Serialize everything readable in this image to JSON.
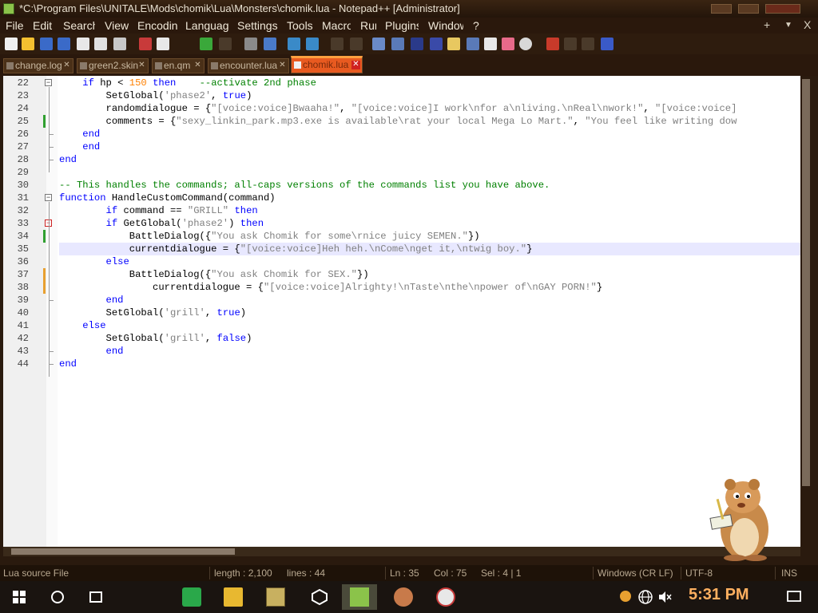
{
  "window": {
    "title": "*C:\\Program Files\\UNITALE\\Mods\\chomik\\Lua\\Monsters\\chomik.lua - Notepad++ [Administrator]"
  },
  "menu": {
    "items": [
      "File",
      "Edit",
      "Search",
      "View",
      "Encoding",
      "Language",
      "Settings",
      "Tools",
      "Macro",
      "Run",
      "Plugins",
      "Window",
      "?"
    ],
    "right_plus": "+",
    "right_down": "▼",
    "right_close": "X"
  },
  "tabs": [
    {
      "label": "change.log",
      "active": false
    },
    {
      "label": "green2.skin",
      "active": false
    },
    {
      "label": "en.qm",
      "active": false
    },
    {
      "label": "encounter.lua",
      "active": false
    },
    {
      "label": "chomik.lua",
      "active": true
    }
  ],
  "editor": {
    "lines": [
      {
        "num": "22",
        "segments": [
          [
            "",
            "    "
          ],
          [
            "kw",
            "if"
          ],
          [
            "",
            " hp < "
          ],
          [
            "num",
            "150"
          ],
          [
            "",
            " "
          ],
          [
            "kw",
            "then"
          ],
          [
            "",
            "    "
          ],
          [
            "cmt",
            "--activate 2nd phase"
          ]
        ]
      },
      {
        "num": "23",
        "segments": [
          [
            "",
            "        SetGlobal("
          ],
          [
            "str",
            "'phase2'"
          ],
          [
            "",
            ", "
          ],
          [
            "kw",
            "true"
          ],
          [
            "",
            ")"
          ]
        ]
      },
      {
        "num": "24",
        "segments": [
          [
            "",
            "        randomdialogue = {"
          ],
          [
            "str",
            "\"[voice:voice]Bwaaha!\""
          ],
          [
            "",
            ", "
          ],
          [
            "str",
            "\"[voice:voice]I work\\nfor a\\nliving.\\nReal\\nwork!\""
          ],
          [
            "",
            ", "
          ],
          [
            "str",
            "\"[voice:voice]"
          ]
        ]
      },
      {
        "num": "25",
        "segments": [
          [
            "",
            "        comments = {"
          ],
          [
            "str",
            "\"sexy_linkin_park.mp3.exe is available\\rat your local Mega Lo Mart.\""
          ],
          [
            "",
            ", "
          ],
          [
            "str",
            "\"You feel like writing dow"
          ]
        ]
      },
      {
        "num": "26",
        "segments": [
          [
            "",
            "    "
          ],
          [
            "kw",
            "end"
          ]
        ]
      },
      {
        "num": "27",
        "segments": [
          [
            "",
            "    "
          ],
          [
            "kw",
            "end"
          ]
        ]
      },
      {
        "num": "28",
        "segments": [
          [
            "kw",
            "end"
          ]
        ]
      },
      {
        "num": "29",
        "segments": [
          [
            "",
            ""
          ]
        ]
      },
      {
        "num": "30",
        "segments": [
          [
            "cmt",
            "-- This handles the commands; all-caps versions of the commands list you have above."
          ]
        ]
      },
      {
        "num": "31",
        "segments": [
          [
            "kw",
            "function"
          ],
          [
            "",
            " HandleCustomCommand(command)"
          ]
        ]
      },
      {
        "num": "32",
        "segments": [
          [
            "",
            "        "
          ],
          [
            "kw",
            "if"
          ],
          [
            "",
            " command == "
          ],
          [
            "str",
            "\"GRILL\""
          ],
          [
            "",
            " "
          ],
          [
            "kw",
            "then"
          ]
        ]
      },
      {
        "num": "33",
        "segments": [
          [
            "",
            "        "
          ],
          [
            "kw",
            "if"
          ],
          [
            "",
            " GetGlobal("
          ],
          [
            "str",
            "'phase2'"
          ],
          [
            "",
            ") "
          ],
          [
            "kw",
            "then"
          ]
        ]
      },
      {
        "num": "34",
        "segments": [
          [
            "",
            "            BattleDialog({"
          ],
          [
            "str",
            "\"You ask Chomik for some\\rnice juicy SEMEN.\""
          ],
          [
            "",
            "})"
          ]
        ]
      },
      {
        "num": "35",
        "segments": [
          [
            "",
            "            currentdialogue = {"
          ],
          [
            "str",
            "\"[voice:voice]Heh heh.\\nCome\\nget it,\\ntwig boy.\""
          ],
          [
            "",
            "}"
          ]
        ]
      },
      {
        "num": "36",
        "segments": [
          [
            "",
            "        "
          ],
          [
            "kw",
            "else"
          ]
        ]
      },
      {
        "num": "37",
        "segments": [
          [
            "",
            "            BattleDialog({"
          ],
          [
            "str",
            "\"You ask Chomik for SEX.\""
          ],
          [
            "",
            "})"
          ]
        ]
      },
      {
        "num": "38",
        "segments": [
          [
            "",
            "                currentdialogue = {"
          ],
          [
            "str",
            "\"[voice:voice]Alrighty!\\nTaste\\nthe\\npower of\\nGAY PORN!\""
          ],
          [
            "",
            "}"
          ]
        ]
      },
      {
        "num": "39",
        "segments": [
          [
            "",
            "        "
          ],
          [
            "kw",
            "end"
          ]
        ]
      },
      {
        "num": "40",
        "segments": [
          [
            "",
            "        SetGlobal("
          ],
          [
            "str",
            "'grill'"
          ],
          [
            "",
            ", "
          ],
          [
            "kw",
            "true"
          ],
          [
            "",
            ")"
          ]
        ]
      },
      {
        "num": "41",
        "segments": [
          [
            "",
            "    "
          ],
          [
            "kw",
            "else"
          ]
        ]
      },
      {
        "num": "42",
        "segments": [
          [
            "",
            "        SetGlobal("
          ],
          [
            "str",
            "'grill'"
          ],
          [
            "",
            ", "
          ],
          [
            "kw",
            "false"
          ],
          [
            "",
            ")"
          ]
        ]
      },
      {
        "num": "43",
        "segments": [
          [
            "",
            "        "
          ],
          [
            "kw",
            "end"
          ]
        ]
      },
      {
        "num": "44",
        "segments": [
          [
            "kw",
            "end"
          ]
        ]
      }
    ],
    "current_line": "35"
  },
  "status": {
    "file_type": "Lua source File",
    "length": "length : 2,100",
    "lines": "lines : 44",
    "ln": "Ln : 35",
    "col": "Col : 75",
    "sel": "Sel : 4 | 1",
    "eol": "Windows (CR LF)",
    "encoding": "UTF-8",
    "mode": "INS"
  },
  "taskbar": {
    "clock": "5:31 PM"
  },
  "colors": {
    "keyword": "#0000ff",
    "string": "#808080",
    "comment": "#008000",
    "number": "#ff8000",
    "active_tab": "#e85a20",
    "clock": "#ffb060"
  }
}
